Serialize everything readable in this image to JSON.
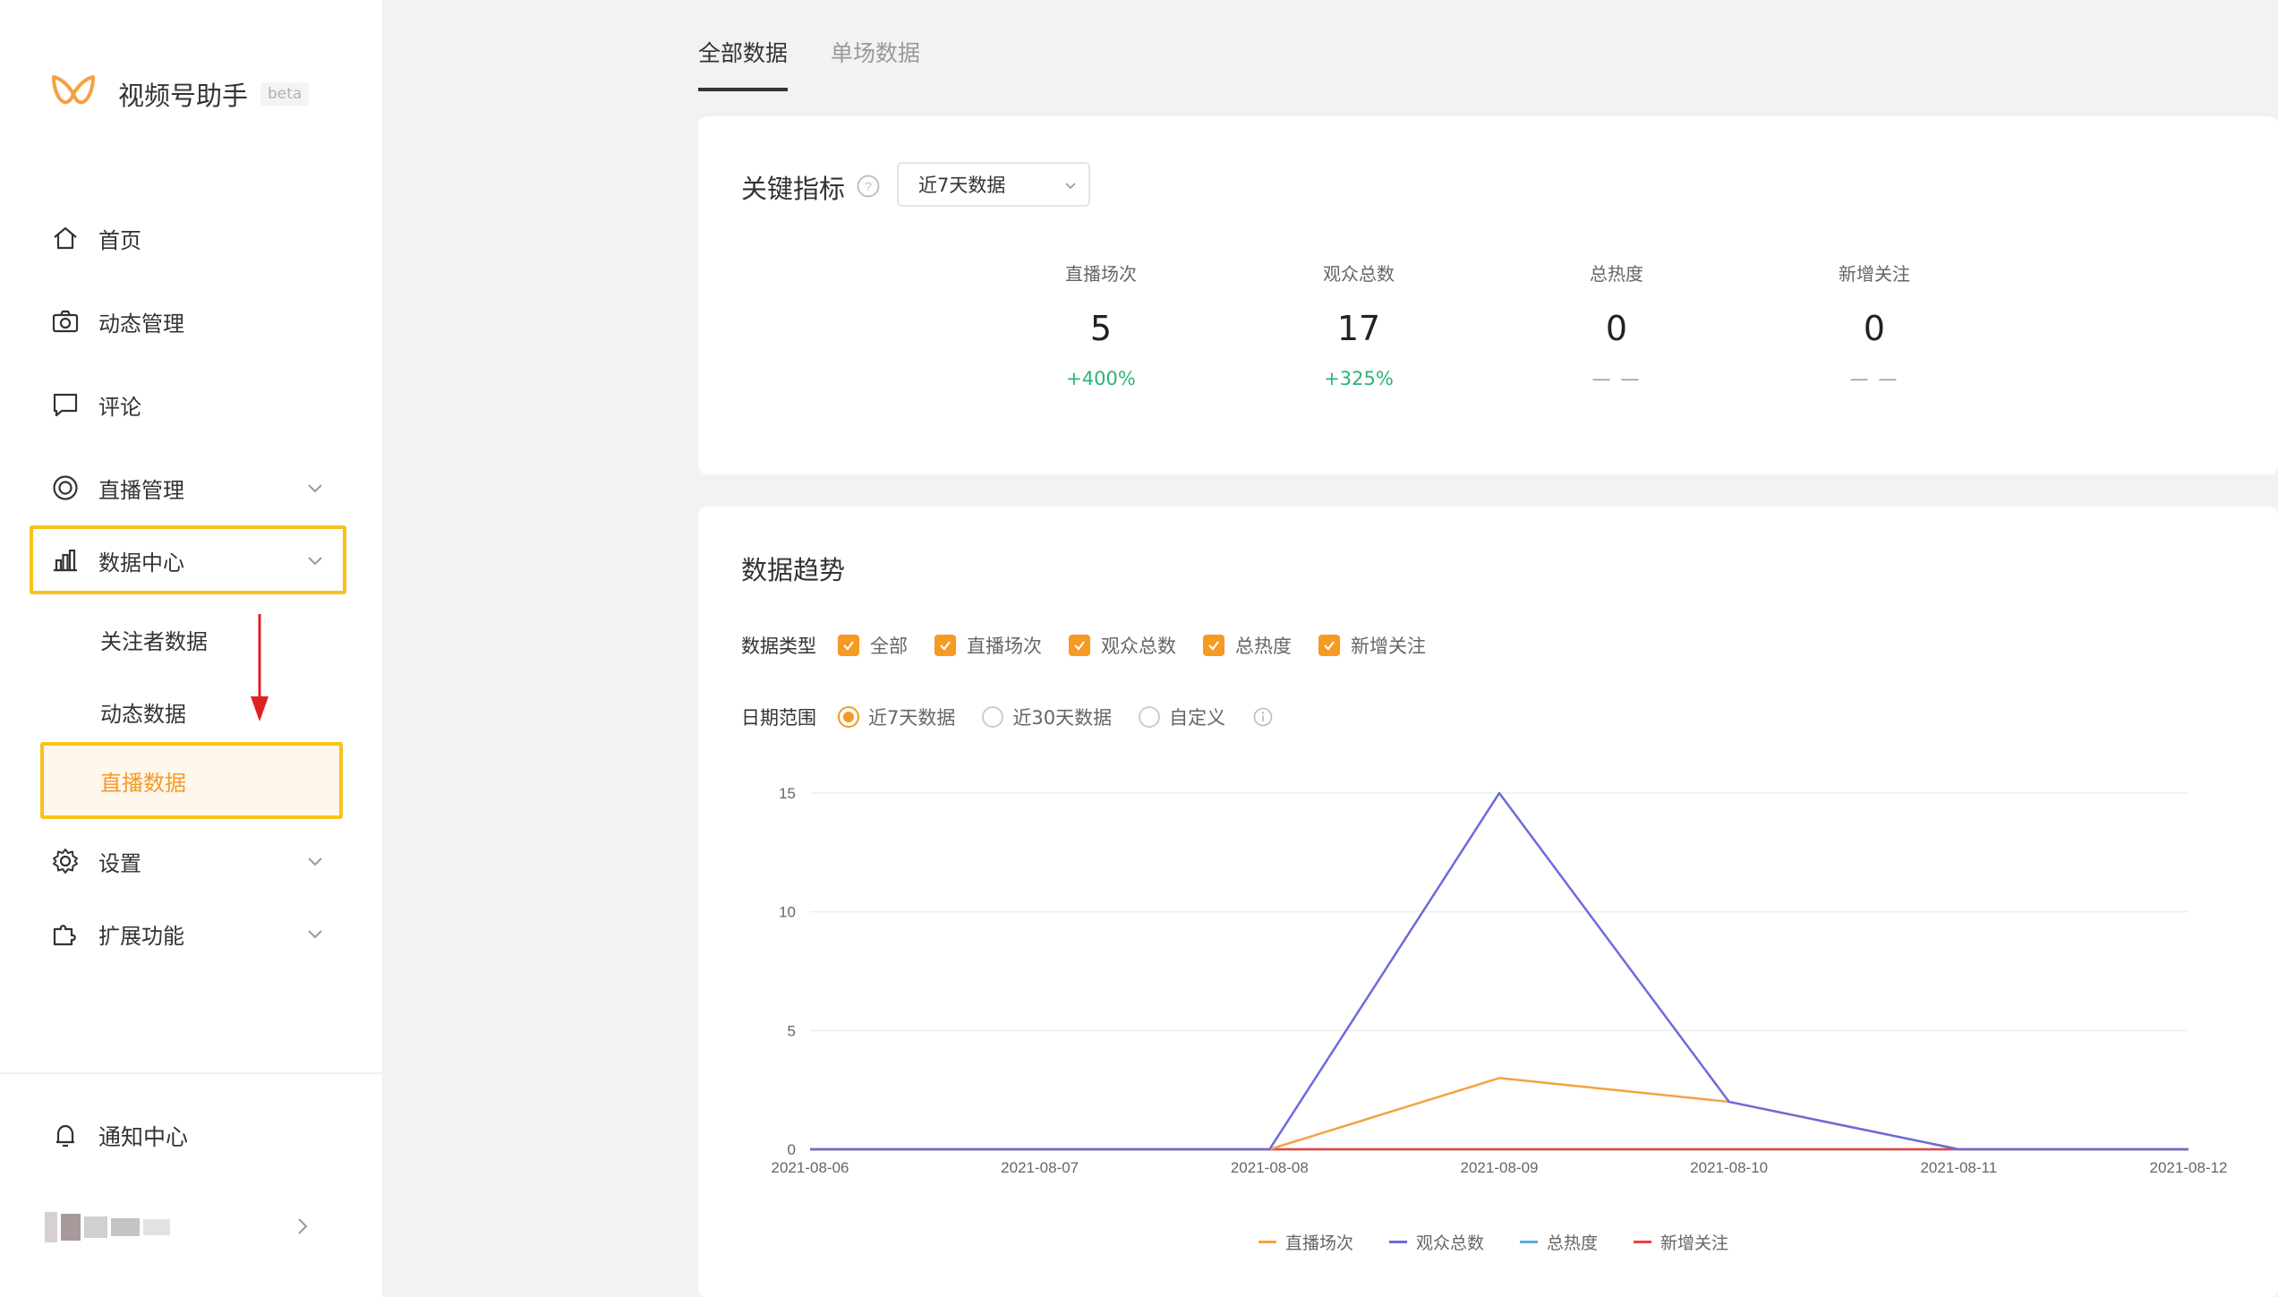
{
  "app": {
    "name": "视频号助手",
    "badge": "beta"
  },
  "sidebar": {
    "items": [
      {
        "label": "首页",
        "icon": "home-icon"
      },
      {
        "label": "动态管理",
        "icon": "camera-icon"
      },
      {
        "label": "评论",
        "icon": "comment-icon"
      },
      {
        "label": "直播管理",
        "icon": "live-icon"
      },
      {
        "label": "数据中心",
        "icon": "bar-chart-icon"
      },
      {
        "label": "设置",
        "icon": "gear-icon"
      },
      {
        "label": "扩展功能",
        "icon": "puzzle-icon"
      }
    ],
    "sub_items": [
      "关注者数据",
      "动态数据",
      "直播数据"
    ],
    "notify_label": "通知中心"
  },
  "tabs": [
    "全部数据",
    "单场数据"
  ],
  "key_metrics": {
    "title": "关键指标",
    "range_select": "近7天数据",
    "items": [
      {
        "label": "直播场次",
        "value": "5",
        "change": "+400%"
      },
      {
        "label": "观众总数",
        "value": "17",
        "change": "+325%"
      },
      {
        "label": "总热度",
        "value": "0",
        "change": "— —"
      },
      {
        "label": "新增关注",
        "value": "0",
        "change": "— —"
      }
    ]
  },
  "trend": {
    "title": "数据趋势",
    "type_label": "数据类型",
    "types": [
      "全部",
      "直播场次",
      "观众总数",
      "总热度",
      "新增关注"
    ],
    "range_label": "日期范围",
    "ranges": [
      "近7天数据",
      "近30天数据",
      "自定义"
    ],
    "selected_range": "近7天数据"
  },
  "colors": {
    "accent": "#f59a23",
    "green": "#2bb673",
    "highlight": "#f9c21a"
  },
  "chart_data": {
    "type": "line",
    "x": [
      "2021-08-06",
      "2021-08-07",
      "2021-08-08",
      "2021-08-09",
      "2021-08-10",
      "2021-08-11",
      "2021-08-12"
    ],
    "ylim": [
      0,
      15
    ],
    "yticks": [
      0,
      5,
      10,
      15
    ],
    "grid": true,
    "legend_position": "bottom",
    "series": [
      {
        "name": "直播场次",
        "color": "#f5a142",
        "values": [
          0,
          0,
          0,
          3,
          2,
          0,
          0
        ]
      },
      {
        "name": "观众总数",
        "color": "#6b6bdc",
        "values": [
          0,
          0,
          0,
          15,
          2,
          0,
          0
        ]
      },
      {
        "name": "总热度",
        "color": "#5aa9e6",
        "values": [
          0,
          0,
          0,
          0,
          0,
          0,
          0
        ]
      },
      {
        "name": "新增关注",
        "color": "#e9443a",
        "values": [
          0,
          0,
          0,
          0,
          0,
          0,
          0
        ]
      }
    ]
  }
}
